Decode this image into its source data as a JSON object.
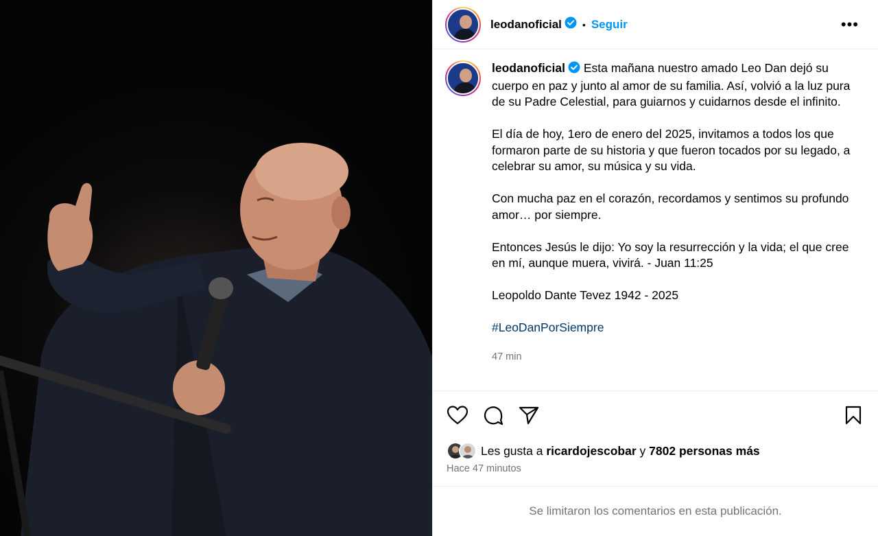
{
  "header": {
    "username": "leodanoficial",
    "separator": "•",
    "follow_label": "Seguir",
    "more_label": "•••",
    "verified_color": "#0095f6"
  },
  "caption": {
    "username": "leodanoficial",
    "paragraphs": [
      "Esta mañana nuestro amado Leo Dan dejó su cuerpo en paz y junto al amor de su familia. Así, volvió a la luz pura de su Padre Celestial, para guiarnos y cuidarnos desde el infinito.",
      "El día de hoy, 1ero de enero del 2025, invitamos a todos los que formaron parte de su historia y que fueron tocados por su legado, a celebrar su amor, su música y su vida.",
      "Con mucha paz en el corazón, recordamos y sentimos su profundo amor… por siempre.",
      "Entonces Jesús le dijo: Yo soy la resurrección y la vida; el que cree en mí, aunque muera, vivirá. - Juan 11:25",
      "Leopoldo Dante Tevez 1942 - 2025"
    ],
    "hashtag": "#LeoDanPorSiempre",
    "hashtag_color": "#00376b",
    "time": "47 min"
  },
  "actions": {
    "icons": [
      "heart-icon",
      "comment-icon",
      "share-icon",
      "bookmark-icon"
    ]
  },
  "likes": {
    "prefix": "Les gusta a",
    "user": "ricardojescobar",
    "conjunction": "y",
    "others": "7802 personas más"
  },
  "post_time": "Hace 47 minutos",
  "comments_notice": "Se limitaron los comentarios en esta publicación.",
  "colors": {
    "accent": "#0095f6",
    "secondary_text": "#737373",
    "divider": "#efefef"
  }
}
